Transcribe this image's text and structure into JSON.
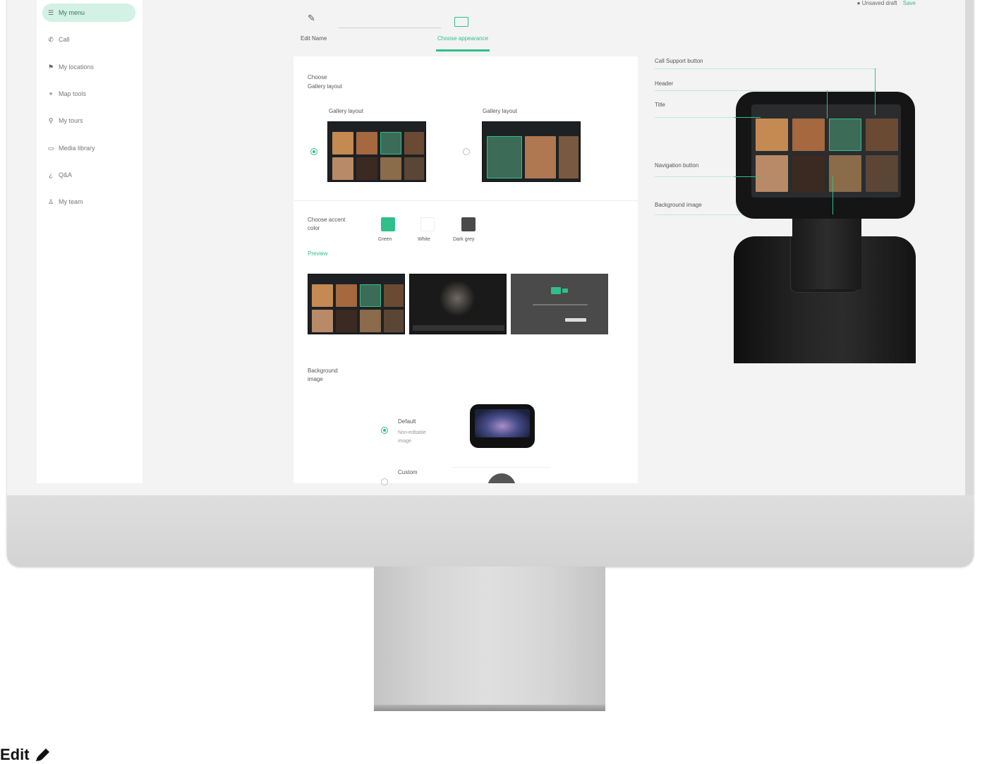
{
  "sidebar": {
    "items": [
      {
        "label": "My menu",
        "icon": "menu-icon",
        "active": true
      },
      {
        "label": "Call",
        "icon": "phone-icon"
      },
      {
        "label": "My locations",
        "icon": "flag-icon"
      },
      {
        "label": "Map tools",
        "icon": "map-icon"
      },
      {
        "label": "My tours",
        "icon": "route-icon"
      },
      {
        "label": "Media library",
        "icon": "media-icon"
      },
      {
        "label": "Q&A",
        "icon": "help-icon"
      },
      {
        "label": "My team",
        "icon": "team-icon"
      }
    ]
  },
  "stepper": {
    "steps": [
      {
        "label": "Edit Name"
      },
      {
        "label": "Choose appearance"
      }
    ]
  },
  "top_right": {
    "status": "Unsaved draft",
    "link": "Save"
  },
  "panel": {
    "layout_section": {
      "label": "Choose",
      "sublabel": "Gallery layout"
    },
    "layout_options": [
      {
        "label": "Gallery layout",
        "selected": true
      },
      {
        "label": "Gallery layout",
        "selected": false
      }
    ],
    "color_section": {
      "label": "Choose accent color"
    },
    "swatches": [
      {
        "label": "Green",
        "color": "#2fbf8a"
      },
      {
        "label": "White",
        "color": "#ffffff"
      },
      {
        "label": "Dark grey",
        "color": "#4a4a4a"
      }
    ],
    "preview_label": "Preview",
    "background_section": {
      "label": "Background",
      "sublabel": "image"
    },
    "background_options": [
      {
        "label": "Default",
        "desc": "Non-editable image",
        "selected": true
      },
      {
        "label": "Custom",
        "selected": false
      }
    ]
  },
  "right": {
    "labels": [
      "Call Support button",
      "Header",
      "Title",
      "Navigation button",
      "Background image"
    ]
  },
  "footer": {
    "edit_label": "Edit",
    "edit_icon": "pencil-icon"
  },
  "colors": {
    "accent": "#2fbf8a",
    "robot": "#151515"
  }
}
